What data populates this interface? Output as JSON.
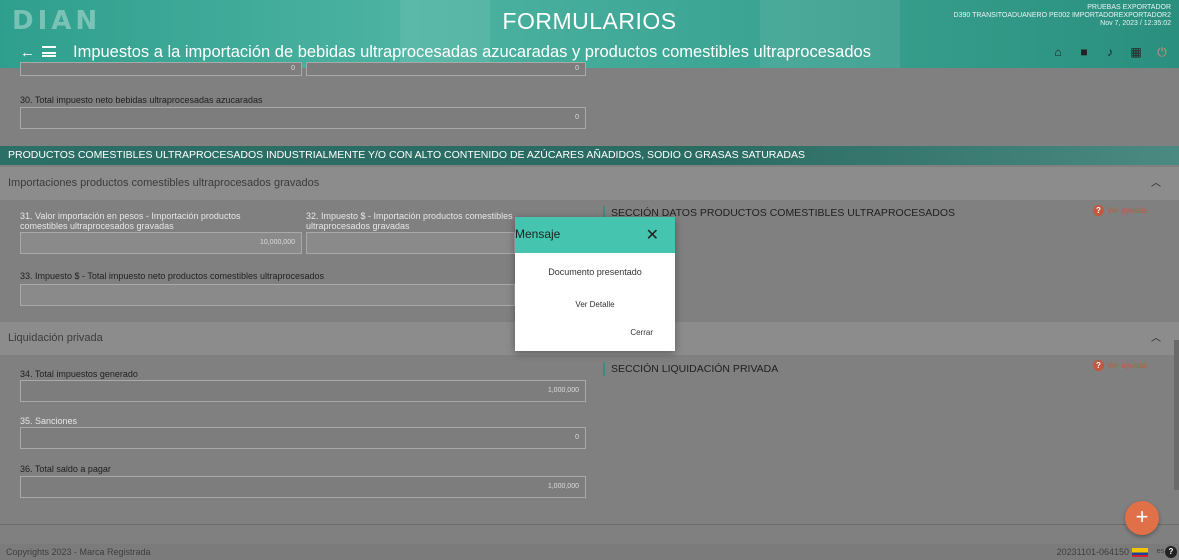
{
  "header": {
    "logo": "DIAN",
    "app_title": "FORMULARIOS",
    "user_name": "PRUEBAS EXPORTADOR",
    "user_role": "D390 TRANSITOADUANERO PE002 IMPORTADOREXPORTADOR2",
    "user_date": "Nov 7, 2023 / 12:35:02",
    "page_title": "Impuestos a la importación de bebidas ultraprocesadas azucaradas y productos comestibles ultraprocesados",
    "icons": [
      "home-icon",
      "folder-icon",
      "bell-icon",
      "calendar-icon",
      "power-icon"
    ]
  },
  "fields": {
    "f30_label": "30. Total impuesto neto bebidas ultraprocesadas azucaradas",
    "f30_value": "0",
    "top_left_value": "0",
    "top_right_value": "0",
    "f31_label": "31. Valor importación en pesos - Importación productos comestibles ultraprocesados gravadas",
    "f31_value": "10,000,000",
    "f32_label": "32. Impuesto $ - Importación productos comestibles ultraprocesados gravadas",
    "f33_label": "33. Impuesto $ - Total impuesto neto productos comestibles ultraprocesados",
    "f34_label": "34. Total impuestos generado",
    "f34_value": "1,000,000",
    "f35_label": "35. Sanciones",
    "f35_value": "0",
    "f36_label": "36. Total saldo a pagar",
    "f36_value": "1,000,000"
  },
  "banner": "PRODUCTOS COMESTIBLES ULTRAPROCESADOS INDUSTRIALMENTE Y/O CON ALTO CONTENIDO DE AZÚCARES AÑADIDOS, SODIO O GRASAS SATURADAS",
  "sections": {
    "importaciones_title": "Importaciones productos comestibles ultraprocesados gravados",
    "importaciones_head": "SECCIÓN DATOS PRODUCTOS COMESTIBLES ULTRAPROCESADOS",
    "liquidacion_title": "Liquidación privada",
    "liquidacion_head": "SECCIÓN LIQUIDACIÓN PRIVADA",
    "help_label": "Ver ayudas"
  },
  "modal": {
    "title": "Mensaje",
    "message": "Documento presentado",
    "link": "Ver Detalle",
    "close_button": "Cerrar"
  },
  "footer": {
    "copyright": "Copyrights 2023 - Marca Registrada",
    "version": "20231101-064150",
    "lang": "es"
  },
  "colors": {
    "accent": "#45c4b0",
    "header": "#3ea694",
    "fab": "#e07048",
    "help": "#c0593f"
  }
}
